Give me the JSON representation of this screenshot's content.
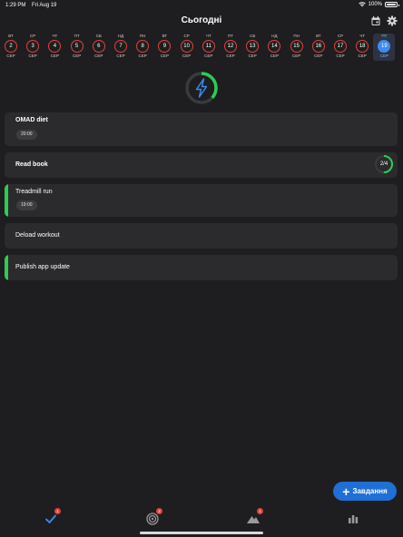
{
  "status_bar": {
    "time": "1:29 PM",
    "date": "Fri Aug 19",
    "battery": "100%"
  },
  "header": {
    "title": "Сьогодні"
  },
  "days": [
    {
      "weekday": "ВТ",
      "day": "2",
      "month": "СЕР"
    },
    {
      "weekday": "СР",
      "day": "3",
      "month": "СЕР"
    },
    {
      "weekday": "ЧТ",
      "day": "4",
      "month": "СЕР"
    },
    {
      "weekday": "ПТ",
      "day": "5",
      "month": "СЕР"
    },
    {
      "weekday": "СБ",
      "day": "6",
      "month": "СЕР"
    },
    {
      "weekday": "НД",
      "day": "7",
      "month": "СЕР"
    },
    {
      "weekday": "ПН",
      "day": "8",
      "month": "СЕР"
    },
    {
      "weekday": "ВТ",
      "day": "9",
      "month": "СЕР"
    },
    {
      "weekday": "СР",
      "day": "10",
      "month": "СЕР"
    },
    {
      "weekday": "ЧТ",
      "day": "11",
      "month": "СЕР"
    },
    {
      "weekday": "ПТ",
      "day": "12",
      "month": "СЕР"
    },
    {
      "weekday": "СБ",
      "day": "13",
      "month": "СЕР"
    },
    {
      "weekday": "НД",
      "day": "14",
      "month": "СЕР"
    },
    {
      "weekday": "ПН",
      "day": "15",
      "month": "СЕР"
    },
    {
      "weekday": "ВТ",
      "day": "16",
      "month": "СЕР"
    },
    {
      "weekday": "СР",
      "day": "17",
      "month": "СЕР"
    },
    {
      "weekday": "ЧТ",
      "day": "18",
      "month": "СЕР"
    },
    {
      "weekday": "ПТ",
      "day": "19",
      "month": "СЕР",
      "selected": true
    }
  ],
  "energy": {
    "icon": "lightning-bolt-icon"
  },
  "tasks": [
    {
      "title": "OMAD diet",
      "time": "20:00",
      "bold": true
    },
    {
      "title": "Read book",
      "progress": "2/4",
      "bold": true,
      "progress_fraction": 0.5
    },
    {
      "title": "Treadmill run",
      "time": "19:00",
      "accent": "#2ecc52"
    },
    {
      "title": "Deload workout"
    },
    {
      "title": "Publish app update",
      "accent": "#2ecc52"
    }
  ],
  "fab": {
    "label": "Завдання"
  },
  "nav": [
    {
      "icon": "checkmark-icon",
      "badge": "1"
    },
    {
      "icon": "target-icon",
      "badge": "2"
    },
    {
      "icon": "mountain-icon",
      "badge": "1"
    },
    {
      "icon": "bar-chart-icon"
    }
  ],
  "colors": {
    "background": "#1e1e20",
    "card": "#2b2b2d",
    "accent_blue": "#1f6fd6",
    "accent_green": "#2ecc52",
    "day_ring": "#e0433a",
    "badge": "#e0433a"
  }
}
